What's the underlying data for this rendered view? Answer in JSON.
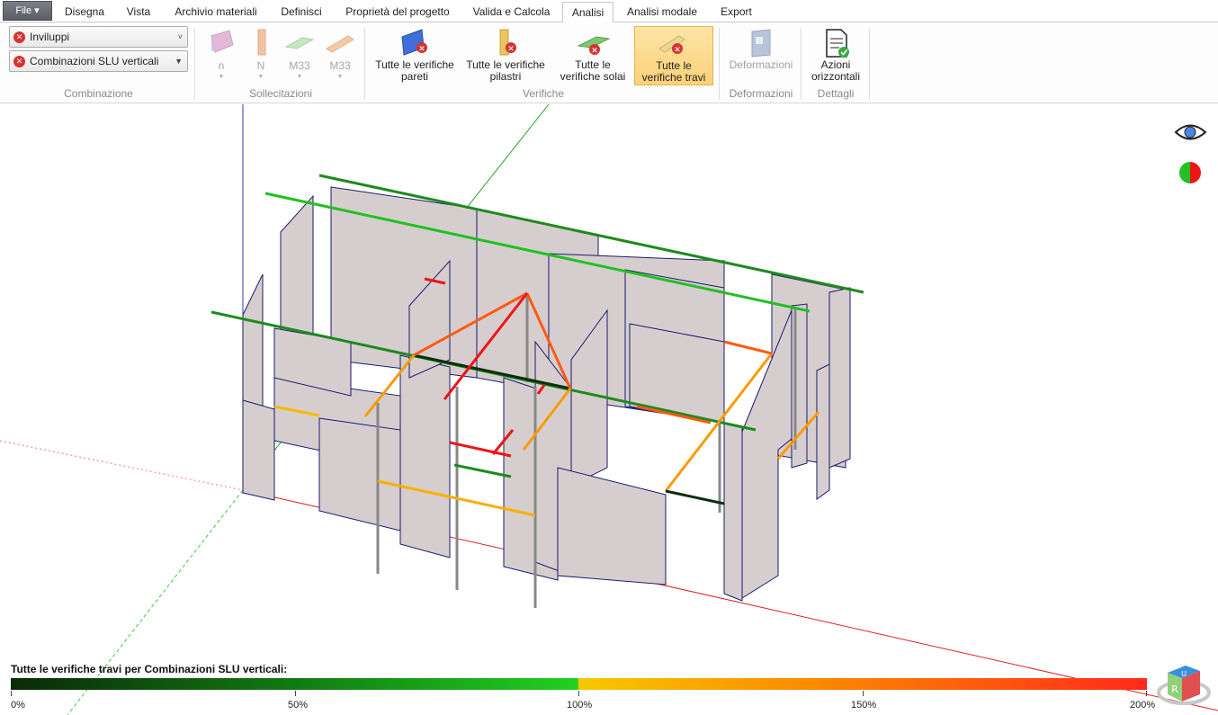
{
  "file_button": "File ▾",
  "tabs": [
    {
      "label": "Disegna"
    },
    {
      "label": "Vista"
    },
    {
      "label": "Archivio materiali"
    },
    {
      "label": "Definisci"
    },
    {
      "label": "Proprietà del progetto"
    },
    {
      "label": "Valida e Calcola"
    },
    {
      "label": "Analisi"
    },
    {
      "label": "Analisi modale"
    },
    {
      "label": "Export"
    }
  ],
  "active_tab": "Analisi",
  "combinazione": {
    "inviluppi": "Inviluppi",
    "combinazioni": "Combinazioni SLU verticali",
    "group_label": "Combinazione"
  },
  "sollecitazioni": {
    "buttons": [
      "n",
      "N",
      "M33",
      "M33"
    ],
    "group_label": "Sollecitazioni"
  },
  "verifiche": {
    "pareti": "Tutte le verifiche pareti",
    "pilastri": "Tutte le verifiche pilastri",
    "solai": "Tutte le verifiche solai",
    "travi": "Tutte le verifiche travi",
    "group_label": "Verifiche"
  },
  "deformazioni": {
    "button": "Deformazioni",
    "group_label": "Deformazioni"
  },
  "dettagli": {
    "button": "Azioni orizzontali",
    "group_label": "Dettagli"
  },
  "legend": {
    "title": "Tutte le verifiche travi per Combinazioni SLU verticali:",
    "ticks": [
      "0%",
      "50%",
      "100%",
      "150%",
      "200%"
    ]
  },
  "navcube": {
    "top": "U",
    "front": "R"
  },
  "colors": {
    "accent_selected": "#fbd27a",
    "status_ok_dark": "#0a2a08",
    "status_ok": "#22d022",
    "status_warn": "#f8c800",
    "status_fail": "#ff2a1a"
  }
}
